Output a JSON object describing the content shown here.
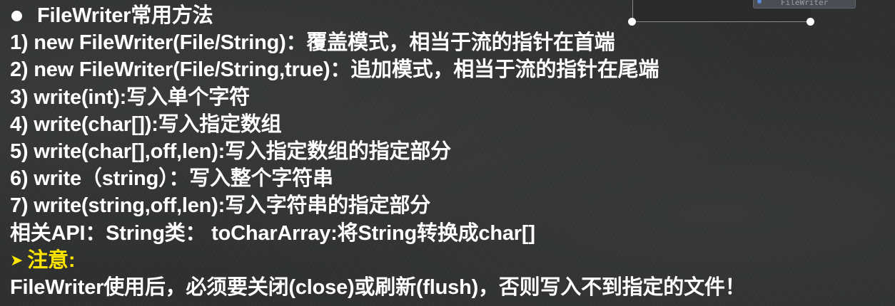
{
  "slide": {
    "title": "FileWriter常用方法",
    "items": [
      "1) new FileWriter(File/String)：覆盖模式，相当于流的指针在首端",
      "2) new FileWriter(File/String,true)：追加模式，相当于流的指针在尾端",
      "3) write(int):写入单个字符",
      "4) write(char[]):写入指定数组",
      "5) write(char[],off,len):写入指定数组的指定部分",
      "6) write（string）：写入整个字符串",
      "7) write(string,off,len):写入字符串的指定部分",
      "相关API：String类： toCharArray:将String转换成char[]"
    ],
    "note_label": "注意:",
    "note_text": "FileWriter使用后，必须要关闭(close)或刷新(flush)，否则写入不到指定的文件！"
  },
  "pip_window": {
    "label": "FileWriter"
  },
  "colors": {
    "background": "#2f3030",
    "text": "#ffffff",
    "note_accent": "#ffe600"
  }
}
